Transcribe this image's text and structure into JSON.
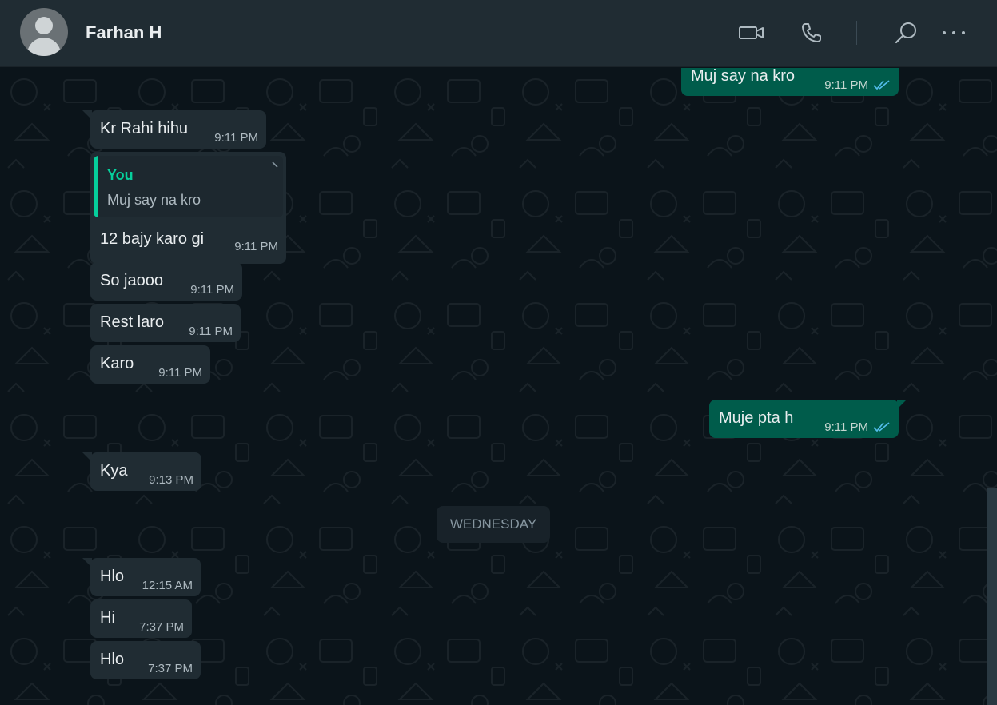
{
  "header": {
    "contact_name": "Farhan H",
    "icons": [
      "video-call-icon",
      "voice-call-icon",
      "search-icon",
      "more-options-icon"
    ]
  },
  "colors": {
    "header_bg": "#202c33",
    "chat_bg": "#0b141a",
    "incoming_bubble": "#202c33",
    "outgoing_bubble": "#005c4b",
    "quote_accent": "#06cf9c",
    "read_ticks": "#53bdeb"
  },
  "messages": [
    {
      "direction": "out",
      "text": "Muj say na kro",
      "time": "9:11 PM",
      "status": "read"
    },
    {
      "direction": "in",
      "text": "Kr Rahi hihu",
      "time": "9:11 PM"
    },
    {
      "direction": "in",
      "reply_to": {
        "author": "You",
        "text": "Muj say na kro"
      },
      "text": "12 bajy karo gi",
      "time": "9:11 PM"
    },
    {
      "direction": "in",
      "text": "So jaooo",
      "time": "9:11 PM"
    },
    {
      "direction": "in",
      "text": "Rest laro",
      "time": "9:11 PM"
    },
    {
      "direction": "in",
      "text": "Karo",
      "time": "9:11 PM"
    },
    {
      "direction": "out",
      "text": "Muje pta h",
      "time": "9:11 PM",
      "status": "read"
    },
    {
      "direction": "in",
      "text": "Kya",
      "time": "9:13 PM"
    },
    {
      "direction": "in",
      "text": "Hlo",
      "time": "12:15 AM"
    },
    {
      "direction": "in",
      "text": "Hi",
      "time": "7:37 PM"
    },
    {
      "direction": "in",
      "text": "Hlo",
      "time": "7:37 PM"
    }
  ],
  "date_separator": "WEDNESDAY"
}
